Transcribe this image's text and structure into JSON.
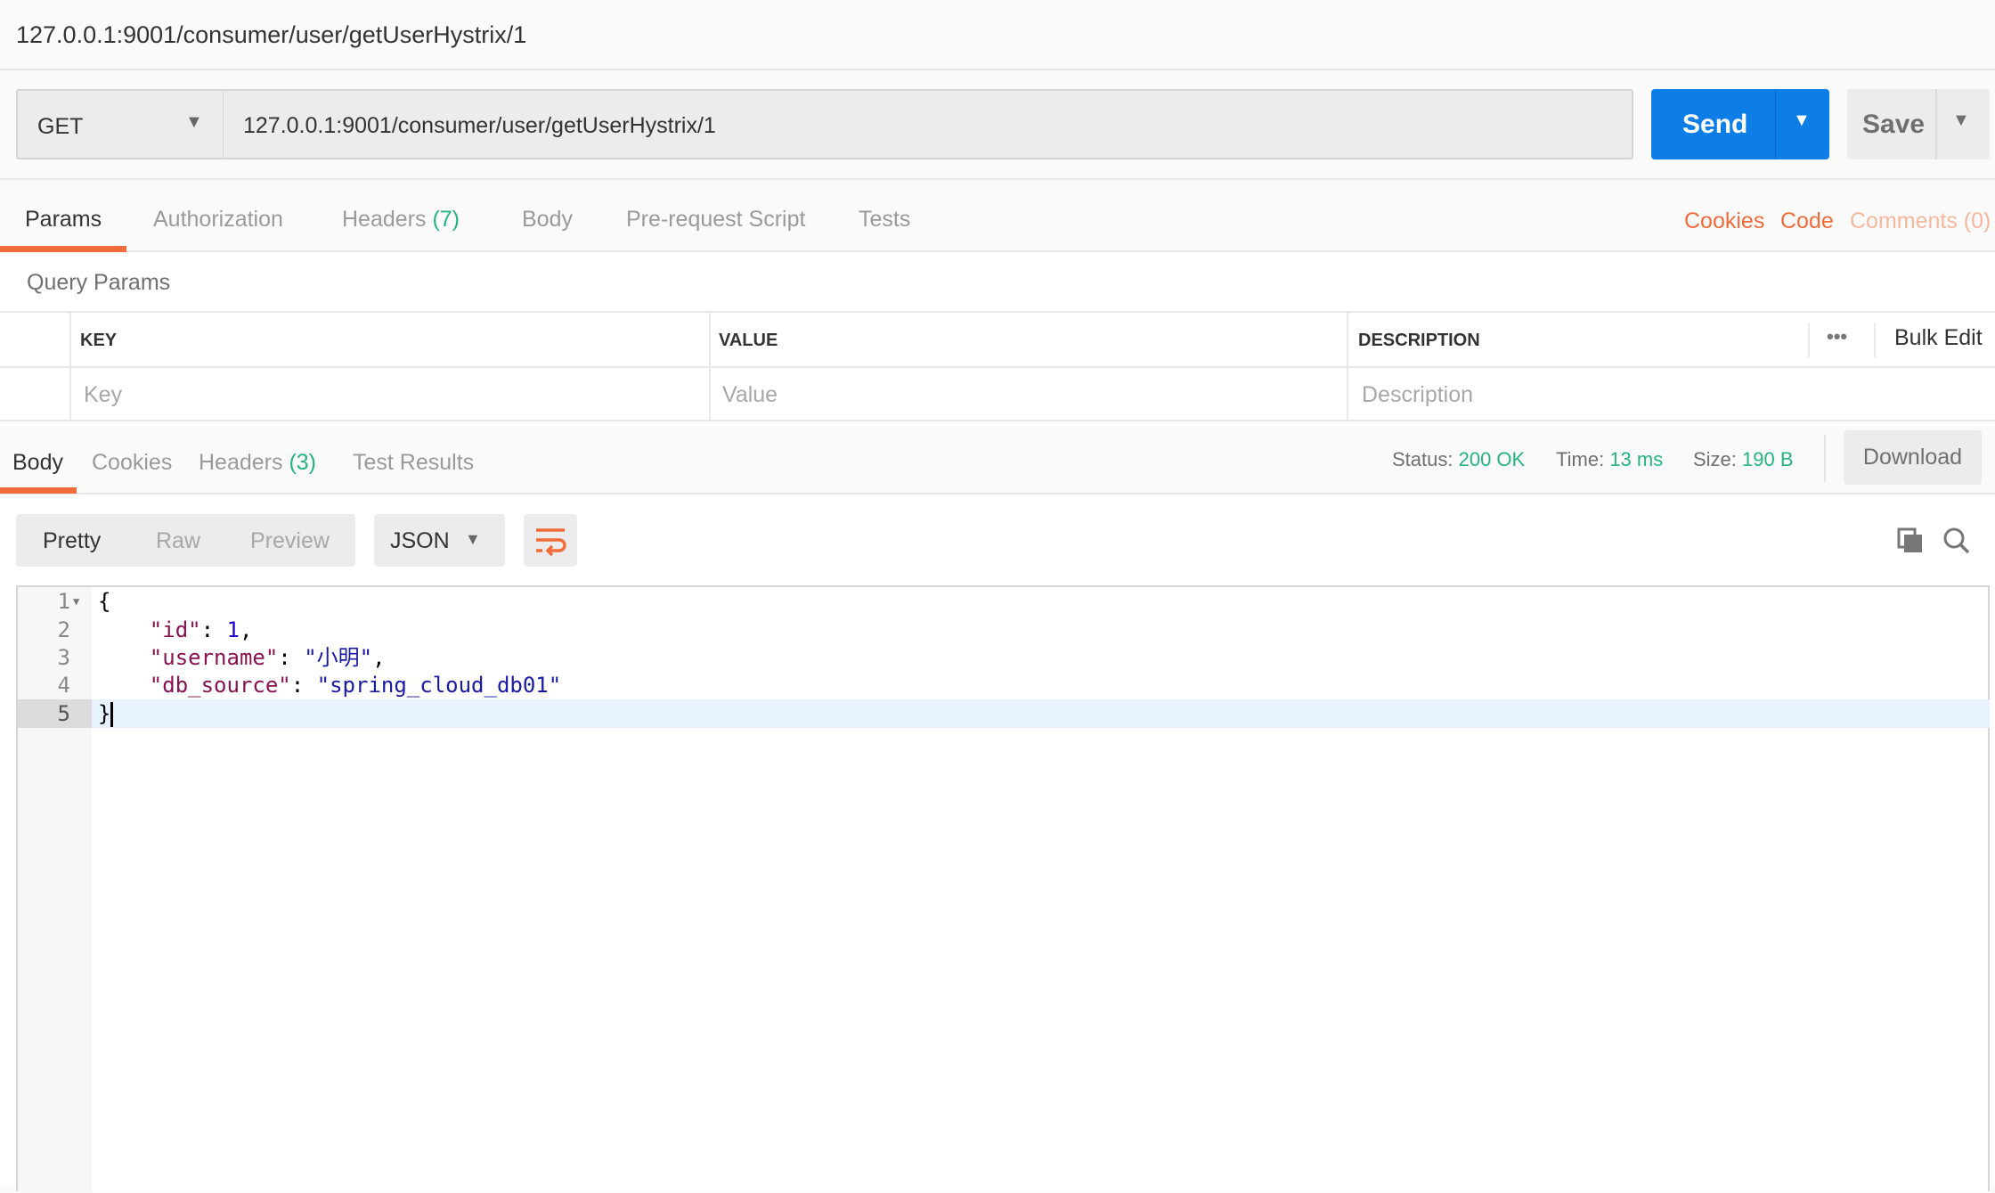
{
  "title": "127.0.0.1:9001/consumer/user/getUserHystrix/1",
  "request": {
    "method": "GET",
    "url": "127.0.0.1:9001/consumer/user/getUserHystrix/1",
    "send_label": "Send",
    "save_label": "Save"
  },
  "request_tabs": [
    {
      "label": "Params",
      "active": true
    },
    {
      "label": "Authorization"
    },
    {
      "label": "Headers",
      "count": "(7)"
    },
    {
      "label": "Body"
    },
    {
      "label": "Pre-request Script"
    },
    {
      "label": "Tests"
    }
  ],
  "request_links": {
    "cookies": "Cookies",
    "code": "Code",
    "comments": "Comments (0)"
  },
  "query_params": {
    "title": "Query Params",
    "columns": [
      "KEY",
      "VALUE",
      "DESCRIPTION"
    ],
    "more": "•••",
    "bulk_edit": "Bulk Edit",
    "placeholders": {
      "key": "Key",
      "value": "Value",
      "description": "Description"
    }
  },
  "response_tabs": [
    {
      "label": "Body",
      "active": true
    },
    {
      "label": "Cookies"
    },
    {
      "label": "Headers",
      "count": "(3)"
    },
    {
      "label": "Test Results"
    }
  ],
  "response_status": {
    "status_label": "Status:",
    "status": "200 OK",
    "time_label": "Time:",
    "time": "13 ms",
    "size_label": "Size:",
    "size": "190 B",
    "download": "Download"
  },
  "body_toolbar": {
    "modes": [
      "Pretty",
      "Raw",
      "Preview"
    ],
    "active_mode": "Pretty",
    "format": "JSON",
    "icons": [
      "wrap-lines-icon",
      "copy-icon",
      "search-icon"
    ]
  },
  "editor": {
    "line_numbers": [
      "1",
      "2",
      "3",
      "4",
      "5"
    ],
    "lines": [
      {
        "open": "{"
      },
      {
        "key": "\"id\"",
        "sep": ": ",
        "value": "1",
        "end": ","
      },
      {
        "key": "\"username\"",
        "sep": ": ",
        "value": "\"小明\"",
        "end": ","
      },
      {
        "key": "\"db_source\"",
        "sep": ": ",
        "value": "\"spring_cloud_db01\"",
        "end": ""
      },
      {
        "close": "}"
      }
    ],
    "active_line": 5
  },
  "colors": {
    "accent": "#f26b3a",
    "send": "#0d7ee8",
    "success": "#26b47f"
  }
}
